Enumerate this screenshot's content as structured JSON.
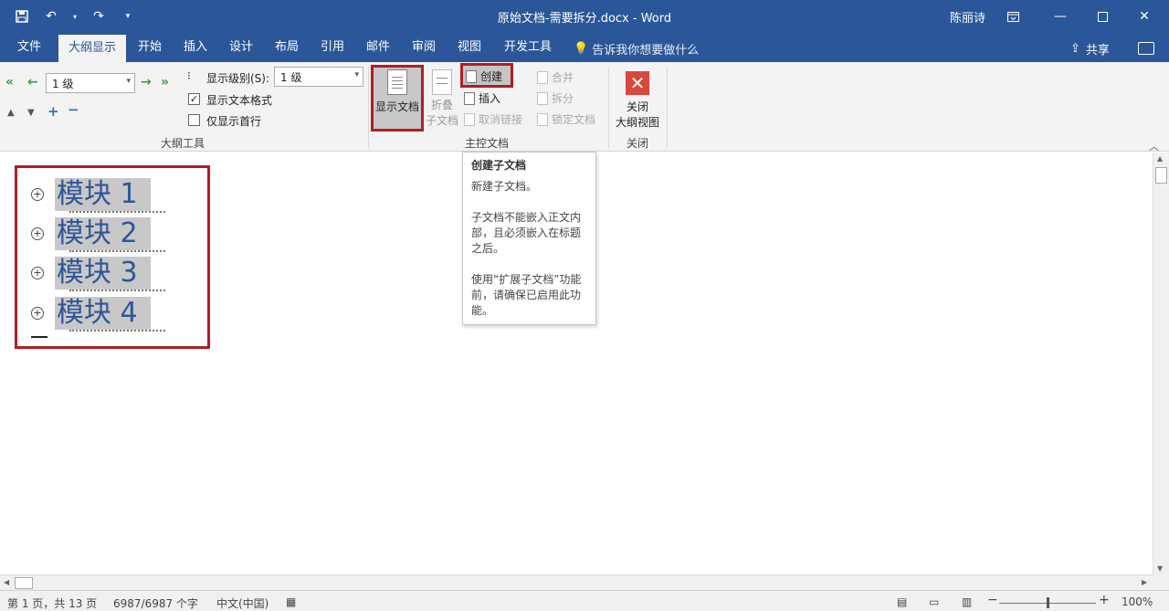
{
  "window": {
    "title": "原始文档-需要拆分.docx  -  Word",
    "user": "陈丽诗"
  },
  "tabs": [
    {
      "label": "文件"
    },
    {
      "label": "大纲显示"
    },
    {
      "label": "开始"
    },
    {
      "label": "插入"
    },
    {
      "label": "设计"
    },
    {
      "label": "布局"
    },
    {
      "label": "引用"
    },
    {
      "label": "邮件"
    },
    {
      "label": "审阅"
    },
    {
      "label": "视图"
    },
    {
      "label": "开发工具"
    }
  ],
  "tellme": "告诉我你想要做什么",
  "share": "共享",
  "outline_tools": {
    "level_value": "1 级",
    "show_level_label": "显示级别(S):",
    "show_level_value": "1 级",
    "show_text_format": "显示文本格式",
    "show_text_format_checked": true,
    "show_first_line": "仅显示首行",
    "show_first_line_checked": false,
    "group_label": "大纲工具"
  },
  "master_doc": {
    "show_document": "显示文档",
    "collapse_line1": "折叠",
    "collapse_line2": "子文档",
    "create": "创建",
    "insert": "插入",
    "unlink": "取消链接",
    "merge": "合并",
    "split": "拆分",
    "lock": "锁定文档",
    "group_label": "主控文档"
  },
  "close_group": {
    "close_line1": "关闭",
    "close_line2": "大纲视图",
    "group_label": "关闭"
  },
  "outline_items": [
    {
      "text": "模块 1"
    },
    {
      "text": "模块 2"
    },
    {
      "text": "模块 3"
    },
    {
      "text": "模块 4"
    }
  ],
  "tooltip": {
    "title": "创建子文档",
    "line1": "新建子文档。",
    "line2": "子文档不能嵌入正文内部，且必须嵌入在标题之后。",
    "line3": "使用“扩展子文档”功能前，请确保已启用此功能。"
  },
  "status": {
    "page": "第 1 页，共 13 页",
    "words": "6987/6987 个字",
    "language": "中文(中国)",
    "zoom": "100%"
  },
  "colors": {
    "title_bar": "#2b579a",
    "highlight_border": "#b11d22",
    "heading_text": "#2f5597"
  }
}
